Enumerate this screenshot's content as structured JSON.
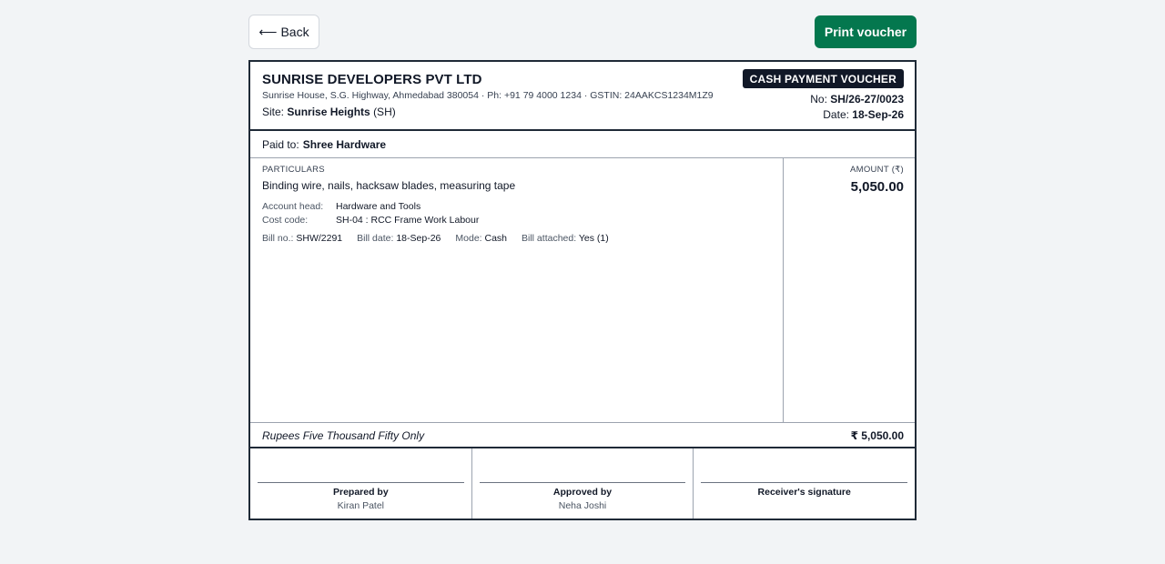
{
  "toolbar": {
    "back_arrow": "⟵",
    "back_label": "Back",
    "print_label": "Print voucher"
  },
  "company": {
    "name": "SUNRISE DEVELOPERS PVT LTD",
    "address_line": "Sunrise House, S.G. Highway, Ahmedabad 380054 · Ph: +91 79 4000 1234 · GSTIN: 24AAKCS1234M1Z9",
    "site_label": "Site:",
    "site_name": "Sunrise Heights",
    "site_code": "(SH)"
  },
  "voucher": {
    "type_badge": "CASH PAYMENT VOUCHER",
    "no_label": "No:",
    "no_value": "SH/26-27/0023",
    "date_label": "Date:",
    "date_value": "18-Sep-26"
  },
  "paid_to": {
    "label": "Paid to:",
    "value": "Shree Hardware"
  },
  "particulars": {
    "header": "PARTICULARS",
    "description": "Binding wire, nails, hacksaw blades, measuring tape",
    "account_head_label": "Account head:",
    "account_head_value": "Hardware and Tools",
    "cost_code_label": "Cost code:",
    "cost_code_value": "SH-04 : RCC Frame Work Labour",
    "bill_no_label": "Bill no.:",
    "bill_no_value": "SHW/2291",
    "bill_date_label": "Bill date:",
    "bill_date_value": "18-Sep-26",
    "mode_label": "Mode:",
    "mode_value": "Cash",
    "bill_attached_label": "Bill attached:",
    "bill_attached_value": "Yes (1)"
  },
  "amount": {
    "header": "AMOUNT (₹)",
    "value": "5,050.00"
  },
  "totals": {
    "words": "Rupees Five Thousand Fifty Only",
    "total": "₹ 5,050.00"
  },
  "signatures": {
    "prepared_label": "Prepared by",
    "prepared_name": "Kiran Patel",
    "approved_label": "Approved by",
    "approved_name": "Neha Joshi",
    "receiver_label": "Receiver's signature"
  },
  "colors": {
    "accent": "#04774e",
    "border": "#1f2a37",
    "badge_bg": "#111827",
    "page_bg": "#f2f4f6"
  }
}
